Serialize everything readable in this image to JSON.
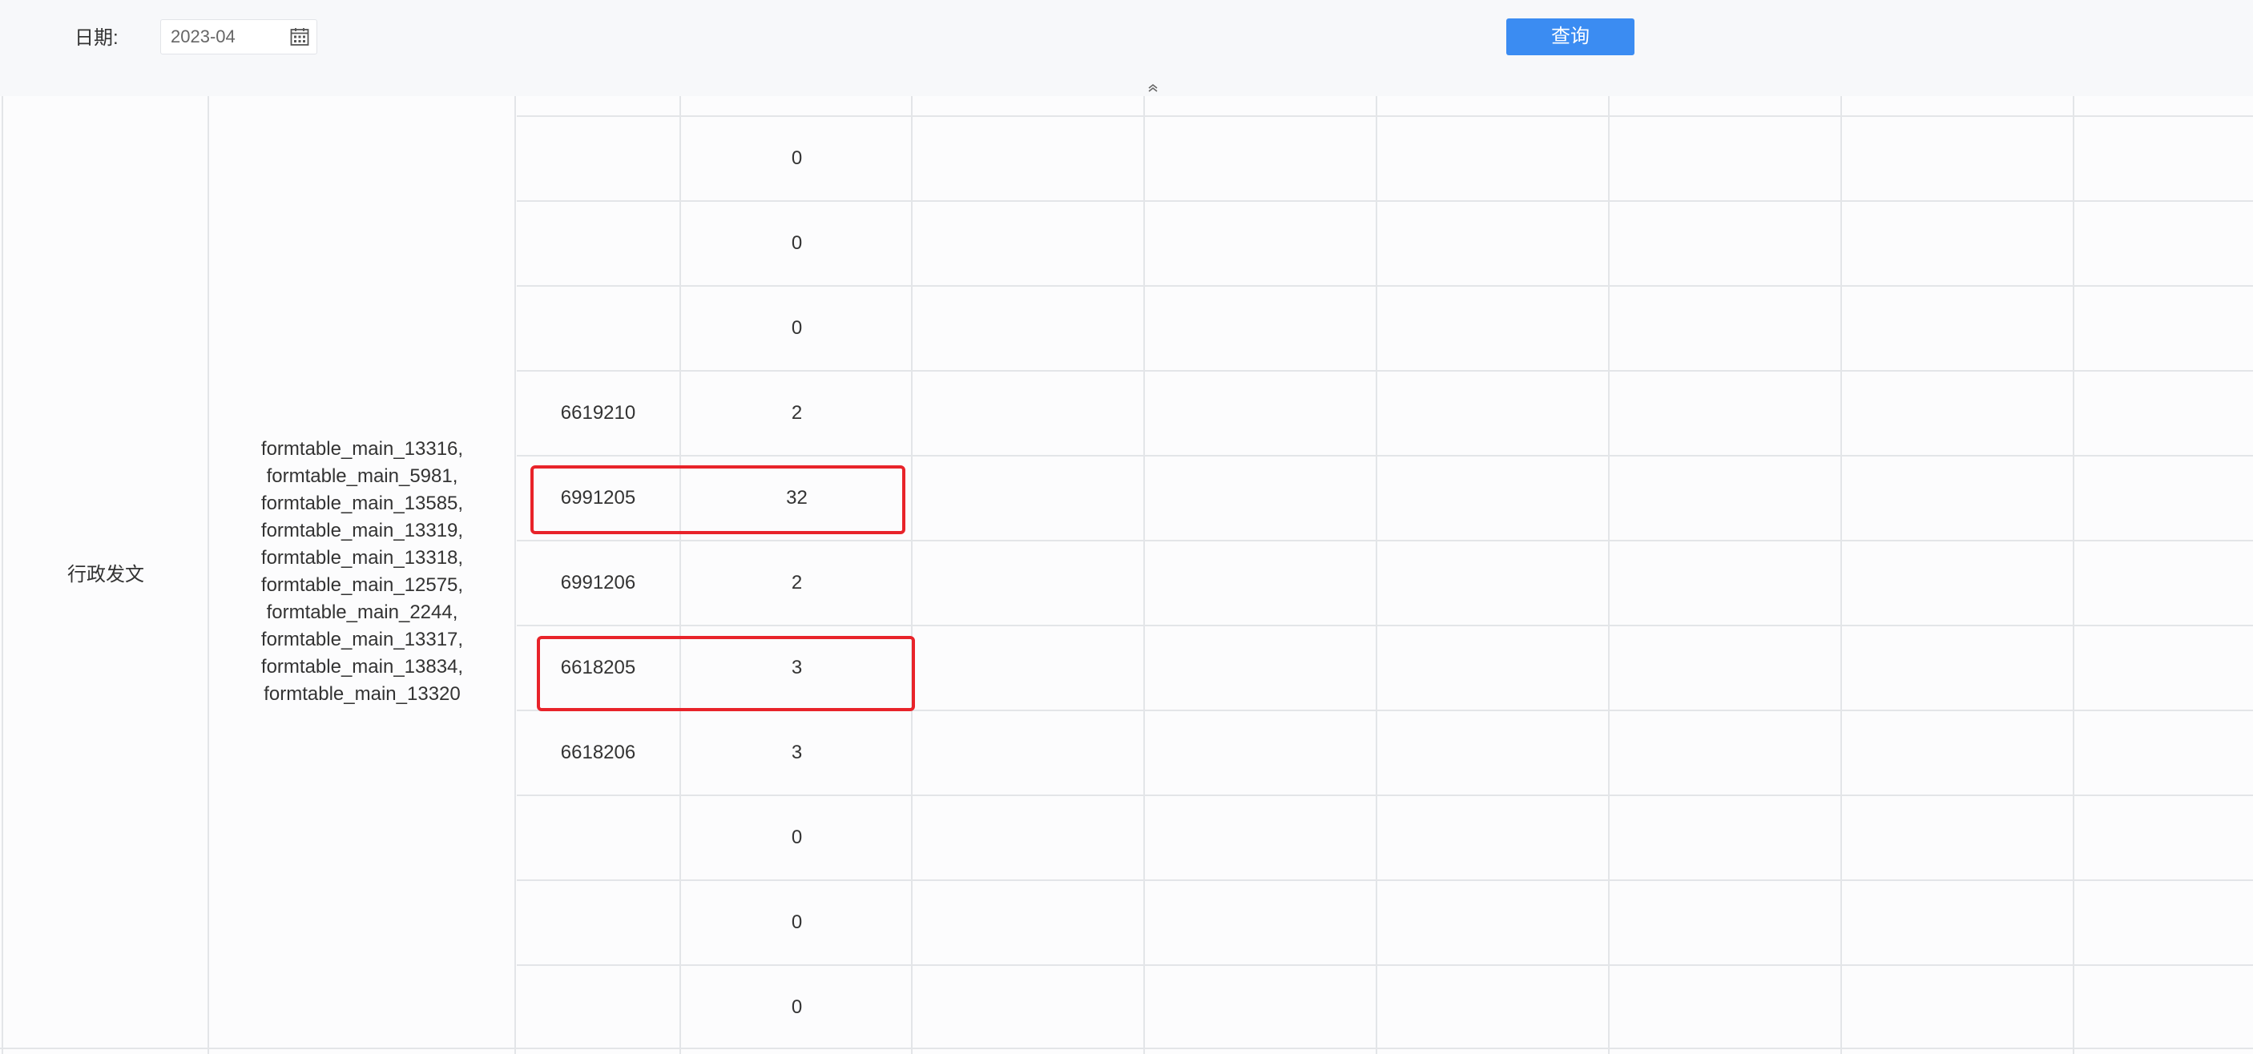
{
  "query_bar": {
    "date_label": "日期:",
    "date_value": "2023-04",
    "query_button_label": "查询"
  },
  "table": {
    "group_name": "行政发文",
    "form_tables": [
      "formtable_main_13316,",
      "formtable_main_5981,",
      "formtable_main_13585,",
      "formtable_main_13319,",
      "formtable_main_13318,",
      "formtable_main_12575,",
      "formtable_main_2244,",
      "formtable_main_13317,",
      "formtable_main_13834,",
      "formtable_main_13320"
    ],
    "rows": [
      {
        "id": "",
        "count": "0"
      },
      {
        "id": "",
        "count": "0"
      },
      {
        "id": "",
        "count": "0"
      },
      {
        "id": "6619210",
        "count": "2"
      },
      {
        "id": "6991205",
        "count": "32",
        "highlighted": true
      },
      {
        "id": "6991206",
        "count": "2"
      },
      {
        "id": "6618205",
        "count": "3",
        "highlighted": true
      },
      {
        "id": "6618206",
        "count": "3"
      },
      {
        "id": "",
        "count": "0"
      },
      {
        "id": "",
        "count": "0"
      },
      {
        "id": "",
        "count": "0"
      }
    ]
  },
  "colors": {
    "primary_button": "#3b8cf2",
    "highlight": "#e8232a",
    "grid_line": "#e3e5e8"
  },
  "icons": {
    "date_picker": "calendar-icon",
    "collapse_toggle": "double-chevron-up-icon"
  }
}
